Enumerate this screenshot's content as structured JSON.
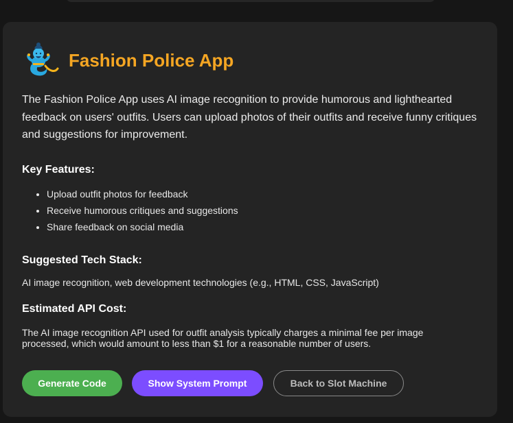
{
  "app": {
    "icon": "genie-icon",
    "title": "Fashion Police App",
    "description": "The Fashion Police App uses AI image recognition to provide humorous and lighthearted feedback on users' outfits. Users can upload photos of their outfits and receive funny critiques and suggestions for improvement."
  },
  "key_features": {
    "heading": "Key Features:",
    "items": [
      "Upload outfit photos for feedback",
      "Receive humorous critiques and suggestions",
      "Share feedback on social media"
    ]
  },
  "tech_stack": {
    "heading": "Suggested Tech Stack:",
    "text": "AI image recognition, web development technologies (e.g., HTML, CSS, JavaScript)"
  },
  "api_cost": {
    "heading": "Estimated API Cost:",
    "text": "The AI image recognition API used for outfit analysis typically charges a minimal fee per image processed, which would amount to less than $1 for a reasonable number of users."
  },
  "buttons": {
    "generate": "Generate Code",
    "system_prompt": "Show System Prompt",
    "back": "Back to Slot Machine"
  },
  "colors": {
    "title": "#f5a623",
    "generate_button": "#4caf50",
    "system_prompt_button": "#7c4dff",
    "card_background": "#242424"
  }
}
